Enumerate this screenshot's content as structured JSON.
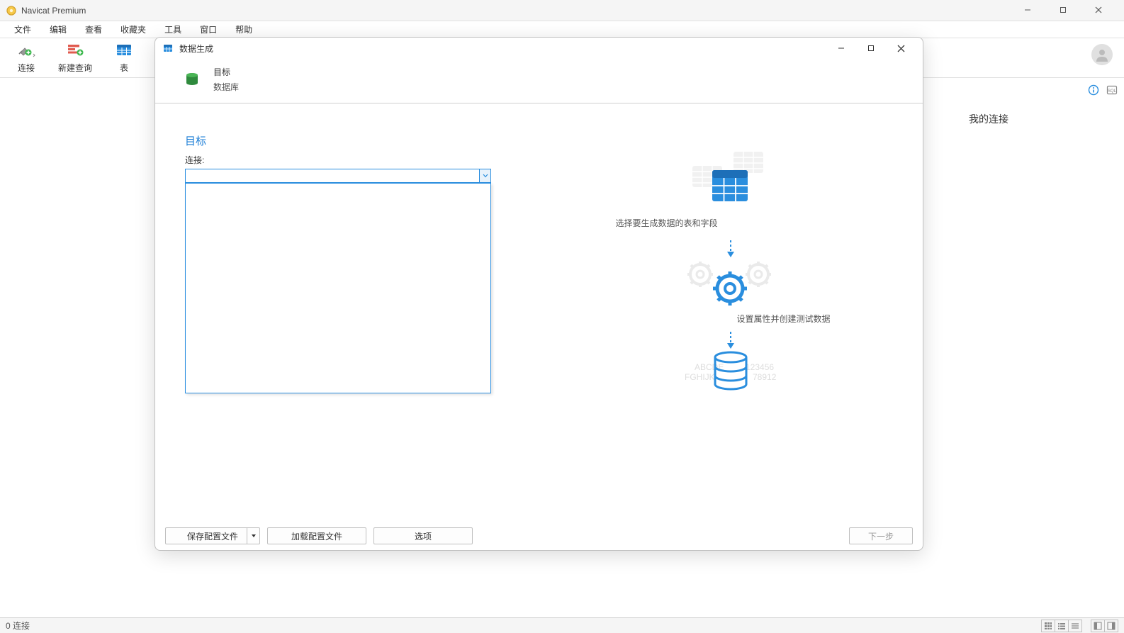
{
  "app": {
    "title": "Navicat Premium"
  },
  "menubar": [
    "文件",
    "编辑",
    "查看",
    "收藏夹",
    "工具",
    "窗口",
    "帮助"
  ],
  "toolbar": {
    "connect": "连接",
    "new_query": "新建查询",
    "table": "表"
  },
  "right_panel": {
    "my_connection": "我的连接"
  },
  "dialog": {
    "title": "数据生成",
    "header": {
      "title": "目标",
      "sub": "数据库"
    },
    "section": {
      "title": "目标",
      "connection_label": "连接:"
    },
    "steps": {
      "step1": "选择要生成数据的表和字段",
      "step2": "设置属性并创建测试数据"
    },
    "illustration": {
      "sample_text_top": "ABCDE",
      "sample_text_mid": "FGHIJK",
      "sample_num_top": "123456",
      "sample_num_bot": "78912"
    },
    "footer": {
      "save": "保存配置文件",
      "load": "加载配置文件",
      "options": "选项",
      "next": "下一步"
    }
  },
  "statusbar": {
    "connections": "0 连接"
  }
}
